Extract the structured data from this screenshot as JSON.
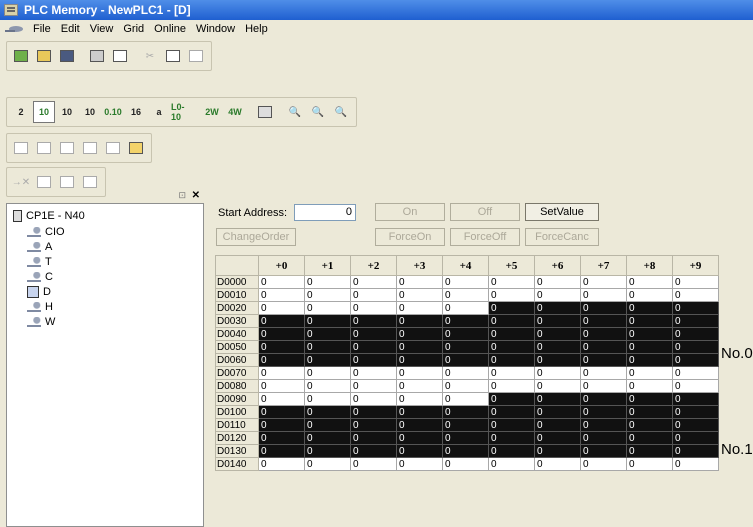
{
  "window": {
    "title": "PLC Memory - NewPLC1 - [D]"
  },
  "menu": [
    "File",
    "Edit",
    "View",
    "Grid",
    "Online",
    "Window",
    "Help"
  ],
  "toolbar": {
    "row2": [
      "2",
      "10",
      "10",
      "10",
      "0.10",
      "16",
      "a",
      "L0-10",
      "2W",
      "4W"
    ]
  },
  "tree": {
    "root": "CP1E - N40",
    "areas": [
      "CIO",
      "A",
      "T",
      "C",
      "D",
      "H",
      "W"
    ]
  },
  "controls": {
    "start_address_label": "Start Address:",
    "start_address_value": "0",
    "on": "On",
    "off": "Off",
    "set_value": "SetValue",
    "change_order": "ChangeOrder",
    "force_on": "ForceOn",
    "force_off": "ForceOff",
    "force_cancel": "ForceCanc"
  },
  "grid": {
    "columns": [
      "+0",
      "+1",
      "+2",
      "+3",
      "+4",
      "+5",
      "+6",
      "+7",
      "+8",
      "+9"
    ],
    "rows": [
      {
        "addr": "D0000",
        "values": [
          "0",
          "0",
          "0",
          "0",
          "0",
          "0",
          "0",
          "0",
          "0",
          "0"
        ]
      },
      {
        "addr": "D0010",
        "values": [
          "0",
          "0",
          "0",
          "0",
          "0",
          "0",
          "0",
          "0",
          "0",
          "0"
        ]
      },
      {
        "addr": "D0020",
        "values": [
          "0",
          "0",
          "0",
          "0",
          "0",
          "0",
          "0",
          "0",
          "0",
          "0"
        ]
      },
      {
        "addr": "D0030",
        "values": [
          "0",
          "0",
          "0",
          "0",
          "0",
          "0",
          "0",
          "0",
          "0",
          "0"
        ]
      },
      {
        "addr": "D0040",
        "values": [
          "0",
          "0",
          "0",
          "0",
          "0",
          "0",
          "0",
          "0",
          "0",
          "0"
        ]
      },
      {
        "addr": "D0050",
        "values": [
          "0",
          "0",
          "0",
          "0",
          "0",
          "0",
          "0",
          "0",
          "0",
          "0"
        ]
      },
      {
        "addr": "D0060",
        "values": [
          "0",
          "0",
          "0",
          "0",
          "0",
          "0",
          "0",
          "0",
          "0",
          "0"
        ]
      },
      {
        "addr": "D0070",
        "values": [
          "0",
          "0",
          "0",
          "0",
          "0",
          "0",
          "0",
          "0",
          "0",
          "0"
        ]
      },
      {
        "addr": "D0080",
        "values": [
          "0",
          "0",
          "0",
          "0",
          "0",
          "0",
          "0",
          "0",
          "0",
          "0"
        ]
      },
      {
        "addr": "D0090",
        "values": [
          "0",
          "0",
          "0",
          "0",
          "0",
          "0",
          "0",
          "0",
          "0",
          "0"
        ]
      },
      {
        "addr": "D0100",
        "values": [
          "0",
          "0",
          "0",
          "0",
          "0",
          "0",
          "0",
          "0",
          "0",
          "0"
        ]
      },
      {
        "addr": "D0110",
        "values": [
          "0",
          "0",
          "0",
          "0",
          "0",
          "0",
          "0",
          "0",
          "0",
          "0"
        ]
      },
      {
        "addr": "D0120",
        "values": [
          "0",
          "0",
          "0",
          "0",
          "0",
          "0",
          "0",
          "0",
          "0",
          "0"
        ]
      },
      {
        "addr": "D0130",
        "values": [
          "0",
          "0",
          "0",
          "0",
          "0",
          "0",
          "0",
          "0",
          "0",
          "0"
        ]
      },
      {
        "addr": "D0140",
        "values": [
          "0",
          "0",
          "0",
          "0",
          "0",
          "0",
          "0",
          "0",
          "0",
          "0"
        ]
      }
    ],
    "dark_cells": [
      [
        2,
        5
      ],
      [
        2,
        6
      ],
      [
        2,
        7
      ],
      [
        2,
        8
      ],
      [
        2,
        9
      ],
      [
        3,
        0
      ],
      [
        3,
        1
      ],
      [
        3,
        2
      ],
      [
        3,
        3
      ],
      [
        3,
        4
      ],
      [
        3,
        5
      ],
      [
        3,
        6
      ],
      [
        3,
        7
      ],
      [
        3,
        8
      ],
      [
        3,
        9
      ],
      [
        4,
        0
      ],
      [
        4,
        1
      ],
      [
        4,
        2
      ],
      [
        4,
        3
      ],
      [
        4,
        4
      ],
      [
        4,
        5
      ],
      [
        4,
        6
      ],
      [
        4,
        7
      ],
      [
        4,
        8
      ],
      [
        4,
        9
      ],
      [
        5,
        0
      ],
      [
        5,
        1
      ],
      [
        5,
        2
      ],
      [
        5,
        3
      ],
      [
        5,
        4
      ],
      [
        5,
        5
      ],
      [
        5,
        6
      ],
      [
        5,
        7
      ],
      [
        5,
        8
      ],
      [
        5,
        9
      ],
      [
        6,
        0
      ],
      [
        6,
        1
      ],
      [
        6,
        2
      ],
      [
        6,
        3
      ],
      [
        6,
        4
      ],
      [
        6,
        5
      ],
      [
        6,
        6
      ],
      [
        6,
        7
      ],
      [
        6,
        8
      ],
      [
        6,
        9
      ],
      [
        9,
        5
      ],
      [
        9,
        6
      ],
      [
        9,
        7
      ],
      [
        9,
        8
      ],
      [
        9,
        9
      ],
      [
        10,
        0
      ],
      [
        10,
        1
      ],
      [
        10,
        2
      ],
      [
        10,
        3
      ],
      [
        10,
        4
      ],
      [
        10,
        5
      ],
      [
        10,
        6
      ],
      [
        10,
        7
      ],
      [
        10,
        8
      ],
      [
        10,
        9
      ],
      [
        11,
        0
      ],
      [
        11,
        1
      ],
      [
        11,
        2
      ],
      [
        11,
        3
      ],
      [
        11,
        4
      ],
      [
        11,
        5
      ],
      [
        11,
        6
      ],
      [
        11,
        7
      ],
      [
        11,
        8
      ],
      [
        11,
        9
      ],
      [
        12,
        0
      ],
      [
        12,
        1
      ],
      [
        12,
        2
      ],
      [
        12,
        3
      ],
      [
        12,
        4
      ],
      [
        12,
        5
      ],
      [
        12,
        6
      ],
      [
        12,
        7
      ],
      [
        12,
        8
      ],
      [
        12,
        9
      ],
      [
        13,
        0
      ],
      [
        13,
        1
      ],
      [
        13,
        2
      ],
      [
        13,
        3
      ],
      [
        13,
        4
      ],
      [
        13,
        5
      ],
      [
        13,
        6
      ],
      [
        13,
        7
      ],
      [
        13,
        8
      ],
      [
        13,
        9
      ]
    ]
  },
  "side_labels": [
    "No.0",
    "No.1"
  ],
  "colors": {
    "title_bar": "#2a66d6",
    "highlight": "#111111"
  }
}
